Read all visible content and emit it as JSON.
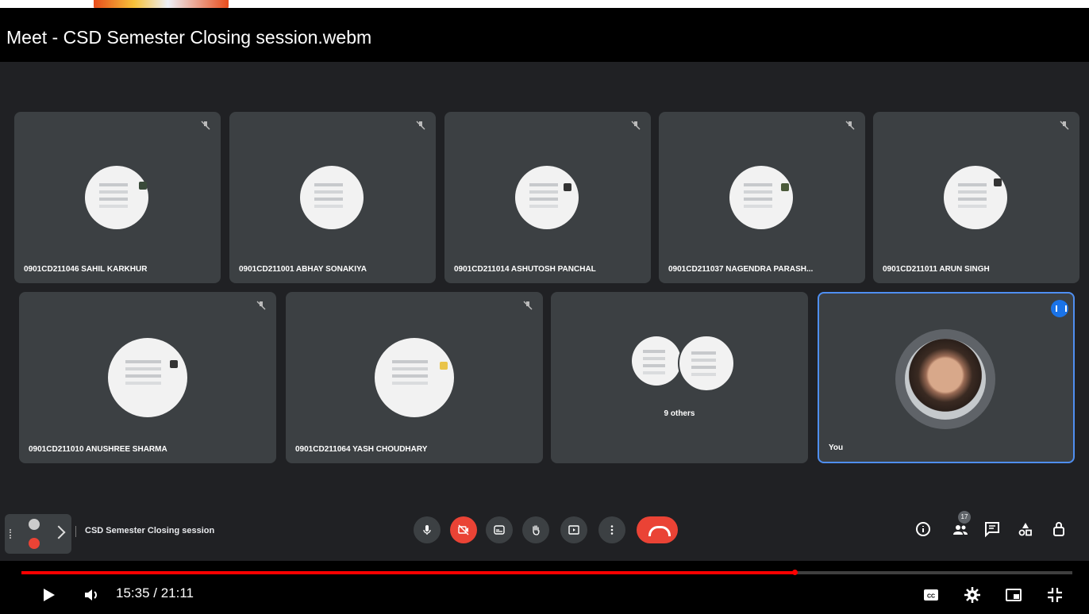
{
  "player": {
    "title": "Meet - CSD Semester Closing session.webm",
    "current_time": "15:35",
    "separator": "/",
    "duration": "21:11",
    "progress_fraction": 0.736,
    "time_display": "15:35 / 21:11"
  },
  "meet": {
    "meeting_name": "CSD Semester Closing session",
    "participant_count": "17",
    "tiles": [
      {
        "name": "0901CD211046 SAHIL KARKHUR"
      },
      {
        "name": "0901CD211001 ABHAY SONAKIYA"
      },
      {
        "name": "0901CD211014 ASHUTOSH PANCHAL"
      },
      {
        "name": "0901CD211037 NAGENDRA PARASH..."
      },
      {
        "name": "0901CD211011 ARUN SINGH"
      },
      {
        "name": "0901CD211010 ANUSHREE SHARMA"
      },
      {
        "name": "0901CD211064 YASH CHOUDHARY"
      },
      {
        "name": "9 others"
      },
      {
        "name": "You"
      }
    ]
  },
  "colors": {
    "accent_red": "#ff0000",
    "hangup": "#ea4335",
    "active_speaker": "#4f8ff2",
    "tile_bg": "#3c4043",
    "stage_bg": "#202124"
  },
  "icons": [
    "mic-muted-icon",
    "mic-icon",
    "camera-off-icon",
    "captions-icon",
    "raise-hand-icon",
    "present-icon",
    "more-options-icon",
    "hangup-icon",
    "info-icon",
    "people-icon",
    "chat-icon",
    "activities-icon",
    "host-controls-icon",
    "play-icon",
    "volume-icon",
    "cc-icon",
    "settings-icon",
    "miniplayer-icon",
    "exit-fullscreen-icon"
  ]
}
